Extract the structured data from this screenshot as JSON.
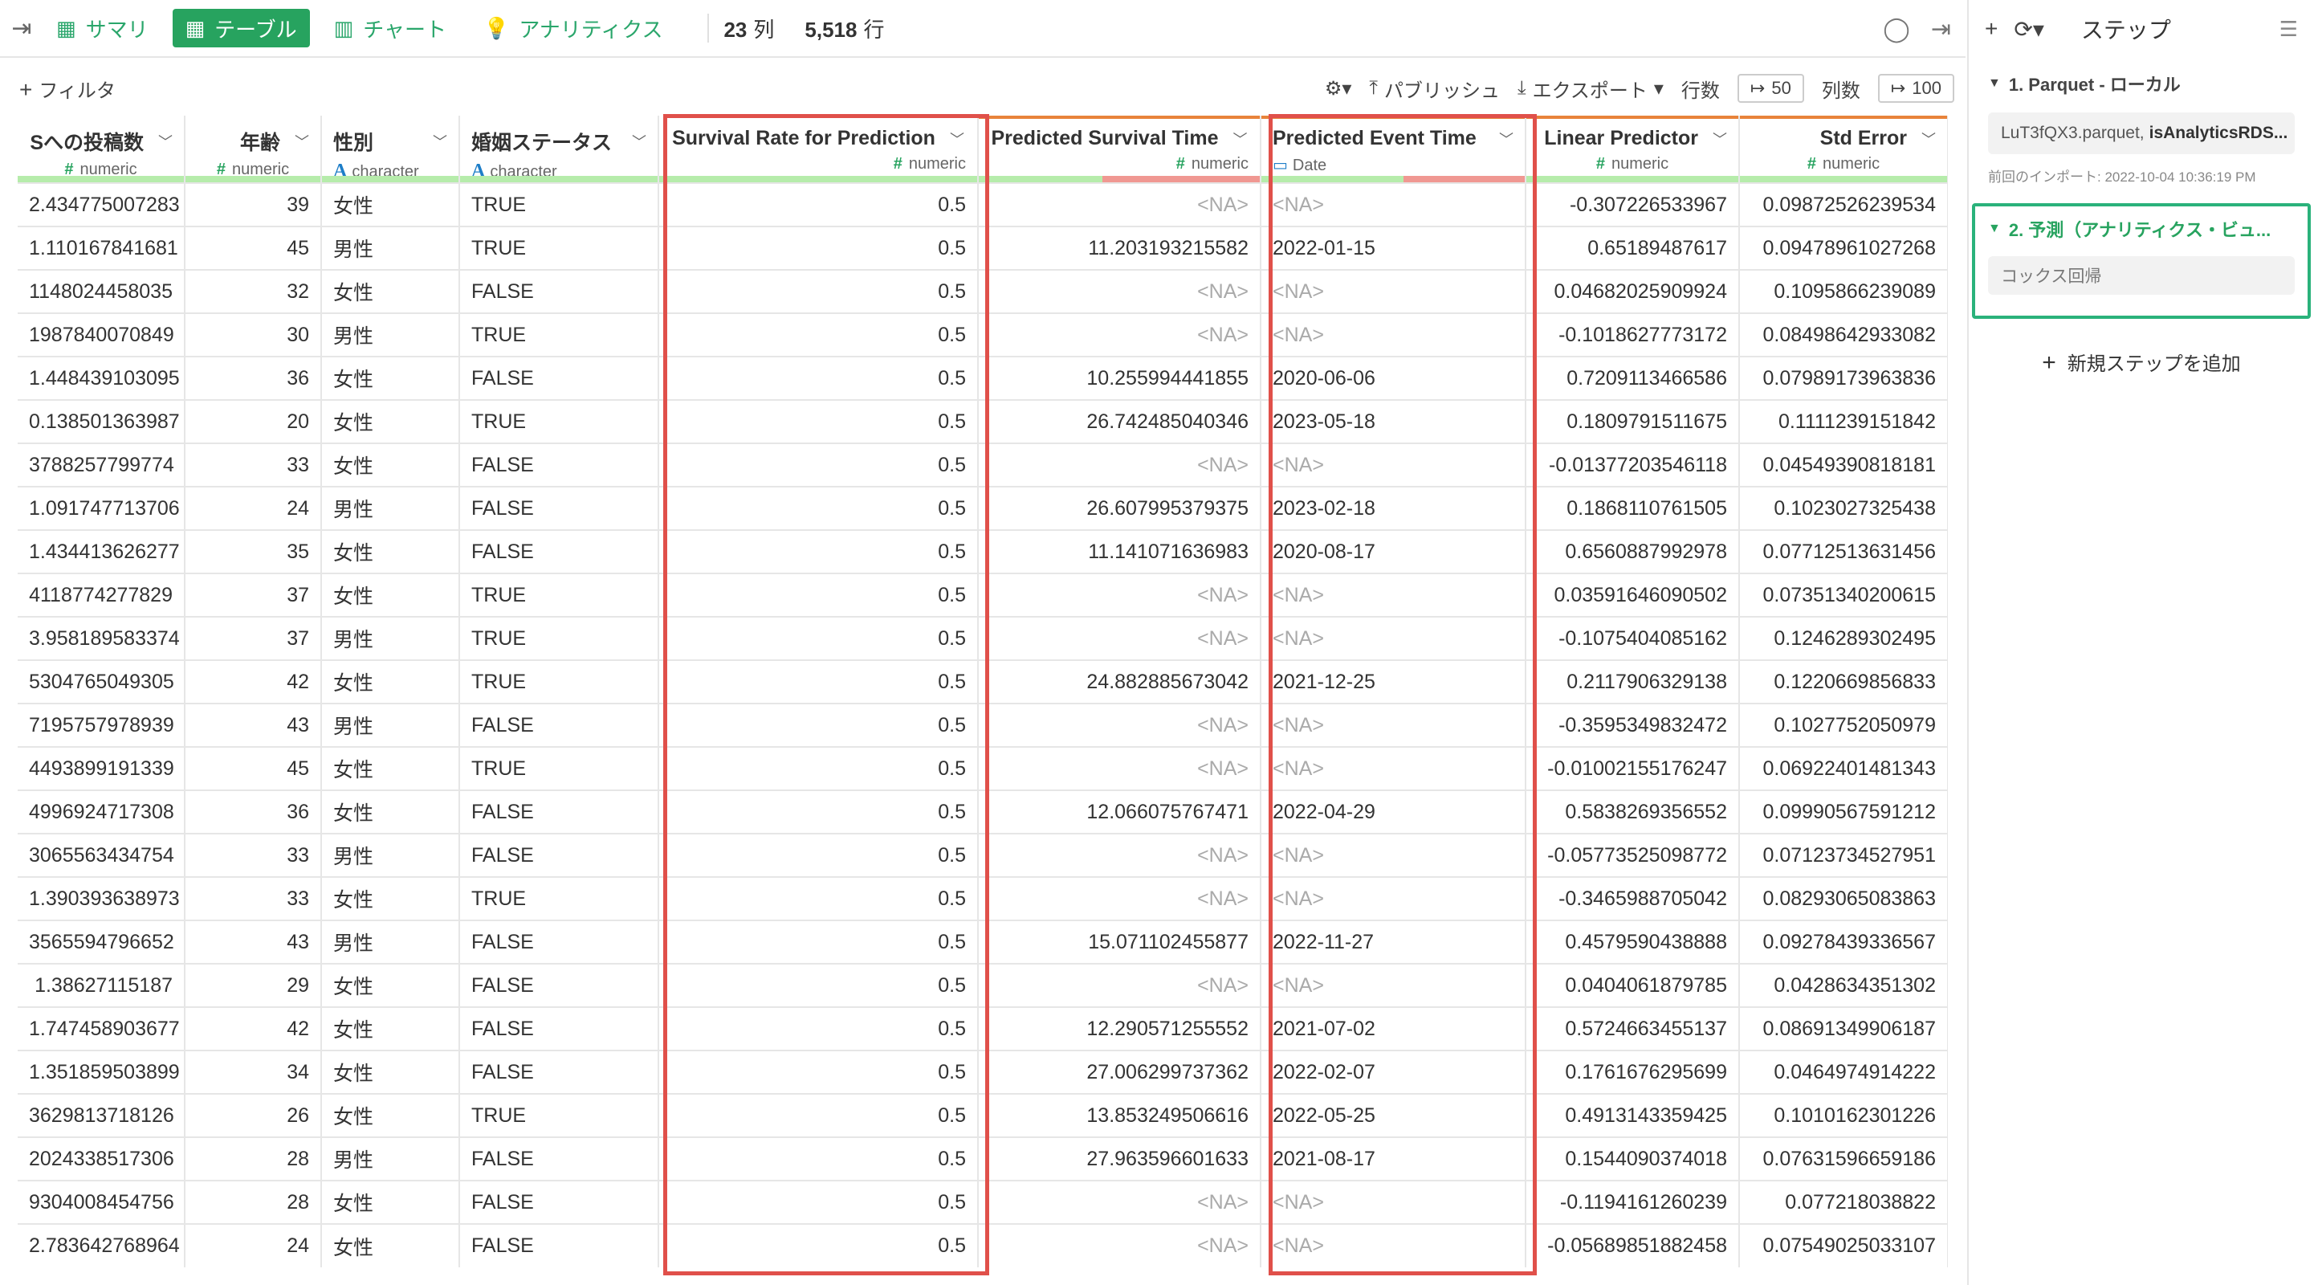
{
  "toolbar": {
    "tabs": [
      {
        "label": "サマリ",
        "icon": "summary-grid-icon"
      },
      {
        "label": "テーブル",
        "icon": "table-icon"
      },
      {
        "label": "チャート",
        "icon": "chart-icon"
      },
      {
        "label": "アナリティクス",
        "icon": "lightbulb-icon"
      }
    ],
    "columns_count": "23",
    "columns_unit": "列",
    "rows_count": "5,518",
    "rows_unit": "行"
  },
  "subbar": {
    "filter_label": "フィルタ",
    "publish_label": "パブリッシュ",
    "export_label": "エクスポート",
    "rows_label": "行数",
    "rows_value": "50",
    "cols_label": "列数",
    "cols_value": "100"
  },
  "columns": [
    {
      "name": "NSへの投稿数",
      "type": "numeric",
      "kind": "num"
    },
    {
      "name": "年齢",
      "type": "numeric",
      "kind": "num"
    },
    {
      "name": "性別",
      "type": "character",
      "kind": "char"
    },
    {
      "name": "婚姻ステータス",
      "type": "character",
      "kind": "char"
    },
    {
      "name": "Survival Rate for Prediction",
      "type": "numeric",
      "kind": "num"
    },
    {
      "name": "Predicted Survival Time",
      "type": "numeric",
      "kind": "num"
    },
    {
      "name": "Predicted Event Time",
      "type": "Date",
      "kind": "date"
    },
    {
      "name": "Linear Predictor",
      "type": "numeric",
      "kind": "num"
    },
    {
      "name": "Std Error",
      "type": "numeric",
      "kind": "num"
    }
  ],
  "rows": [
    [
      "2.434775007283",
      "39",
      "女性",
      "TRUE",
      "0.5",
      "<NA>",
      "<NA>",
      "-0.307226533967",
      "0.09872526239534"
    ],
    [
      "1.110167841681",
      "45",
      "男性",
      "TRUE",
      "0.5",
      "11.203193215582",
      "2022-01-15",
      "0.65189487617",
      "0.09478961027268"
    ],
    [
      "1148024458035",
      "32",
      "女性",
      "FALSE",
      "0.5",
      "<NA>",
      "<NA>",
      "0.04682025909924",
      "0.1095866239089"
    ],
    [
      "1987840070849",
      "30",
      "男性",
      "TRUE",
      "0.5",
      "<NA>",
      "<NA>",
      "-0.1018627773172",
      "0.08498642933082"
    ],
    [
      "1.448439103095",
      "36",
      "女性",
      "FALSE",
      "0.5",
      "10.255994441855",
      "2020-06-06",
      "0.7209113466586",
      "0.07989173963836"
    ],
    [
      "0.138501363987",
      "20",
      "女性",
      "TRUE",
      "0.5",
      "26.742485040346",
      "2023-05-18",
      "0.1809791511675",
      "0.1111239151842"
    ],
    [
      "3788257799774",
      "33",
      "女性",
      "FALSE",
      "0.5",
      "<NA>",
      "<NA>",
      "-0.01377203546118",
      "0.04549390818181"
    ],
    [
      "1.091747713706",
      "24",
      "男性",
      "FALSE",
      "0.5",
      "26.607995379375",
      "2023-02-18",
      "0.1868110761505",
      "0.1023027325438"
    ],
    [
      "1.434413626277",
      "35",
      "女性",
      "FALSE",
      "0.5",
      "11.141071636983",
      "2020-08-17",
      "0.6560887992978",
      "0.07712513631456"
    ],
    [
      "4118774277829",
      "37",
      "女性",
      "TRUE",
      "0.5",
      "<NA>",
      "<NA>",
      "0.03591646090502",
      "0.07351340200615"
    ],
    [
      "3.958189583374",
      "37",
      "男性",
      "TRUE",
      "0.5",
      "<NA>",
      "<NA>",
      "-0.1075404085162",
      "0.1246289302495"
    ],
    [
      "5304765049305",
      "42",
      "女性",
      "TRUE",
      "0.5",
      "24.882885673042",
      "2021-12-25",
      "0.2117906329138",
      "0.1220669856833"
    ],
    [
      "7195757978939",
      "43",
      "男性",
      "FALSE",
      "0.5",
      "<NA>",
      "<NA>",
      "-0.3595349832472",
      "0.1027752050979"
    ],
    [
      "4493899191339",
      "45",
      "女性",
      "TRUE",
      "0.5",
      "<NA>",
      "<NA>",
      "-0.01002155176247",
      "0.06922401481343"
    ],
    [
      "4996924717308",
      "36",
      "女性",
      "FALSE",
      "0.5",
      "12.066075767471",
      "2022-04-29",
      "0.5838269356552",
      "0.09990567591212"
    ],
    [
      "3065563434754",
      "33",
      "男性",
      "FALSE",
      "0.5",
      "<NA>",
      "<NA>",
      "-0.05773525098772",
      "0.07123734527951"
    ],
    [
      "1.390393638973",
      "33",
      "女性",
      "TRUE",
      "0.5",
      "<NA>",
      "<NA>",
      "-0.3465988705042",
      "0.08293065083863"
    ],
    [
      "3565594796652",
      "43",
      "男性",
      "FALSE",
      "0.5",
      "15.071102455877",
      "2022-11-27",
      "0.4579590438888",
      "0.09278439336567"
    ],
    [
      "1.38627115187",
      "29",
      "女性",
      "FALSE",
      "0.5",
      "<NA>",
      "<NA>",
      "0.0404061879785",
      "0.0428634351302"
    ],
    [
      "1.747458903677",
      "42",
      "女性",
      "FALSE",
      "0.5",
      "12.290571255552",
      "2021-07-02",
      "0.5724663455137",
      "0.08691349906187"
    ],
    [
      "1.351859503899",
      "34",
      "女性",
      "FALSE",
      "0.5",
      "27.006299737362",
      "2022-02-07",
      "0.1761676295699",
      "0.0464974914222"
    ],
    [
      "3629813718126",
      "26",
      "女性",
      "TRUE",
      "0.5",
      "13.853249506616",
      "2022-05-25",
      "0.4913143359425",
      "0.1010162301226"
    ],
    [
      "2024338517306",
      "28",
      "男性",
      "FALSE",
      "0.5",
      "27.963596601633",
      "2021-08-17",
      "0.1544090374018",
      "0.07631596659186"
    ],
    [
      "9304008454756",
      "28",
      "女性",
      "FALSE",
      "0.5",
      "<NA>",
      "<NA>",
      "-0.1194161260239",
      "0.077218038822"
    ],
    [
      "2.783642768964",
      "24",
      "女性",
      "FALSE",
      "0.5",
      "<NA>",
      "<NA>",
      "-0.05689851882458",
      "0.07549025033107"
    ]
  ],
  "panel": {
    "title": "ステップ",
    "step1_title": "1. Parquet - ローカル",
    "step1_file": "LuT3fQX3.parquet,",
    "step1_file_bold": "isAnalyticsRDS...",
    "step1_note": "前回のインポート: 2022-10-04 10:36:19 PM",
    "step2_title": "2. 予測（アナリティクス・ビュ...",
    "step2_box": "コックス回帰",
    "add_step": "新規ステップを追加"
  },
  "colors": {
    "accent_green": "#27a35f",
    "highlight_red": "#e0504a",
    "valid_bar": "#b6ecab",
    "na_bar": "#f09892"
  }
}
